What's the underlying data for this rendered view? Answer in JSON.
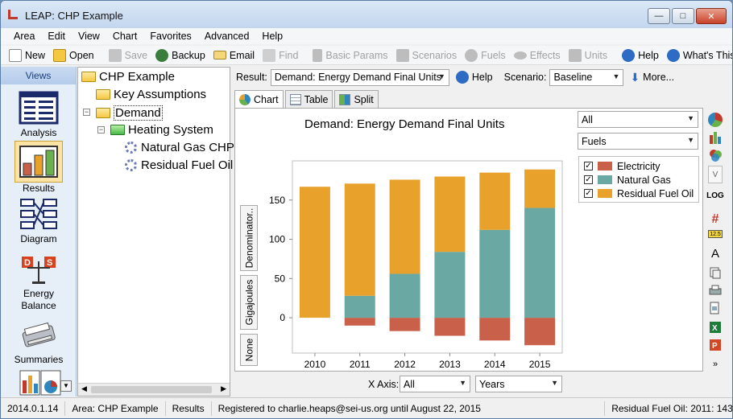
{
  "window": {
    "title": "LEAP: CHP Example",
    "controls": {
      "minimize": "—",
      "maximize": "□",
      "close": "✕"
    }
  },
  "menu": [
    "Area",
    "Edit",
    "View",
    "Chart",
    "Favorites",
    "Advanced",
    "Help"
  ],
  "toolbar": {
    "new": "New",
    "open": "Open",
    "save": "Save",
    "backup": "Backup",
    "email": "Email",
    "find": "Find",
    "basic_params": "Basic Params",
    "scenarios": "Scenarios",
    "fuels": "Fuels",
    "effects": "Effects",
    "units": "Units",
    "help": "Help",
    "whats_this": "What's This?"
  },
  "views": {
    "header": "Views",
    "items": [
      "Analysis",
      "Results",
      "Diagram",
      "Energy Balance",
      "Summaries"
    ],
    "active": "Results"
  },
  "tree": {
    "root": "CHP Example",
    "key_assumptions": "Key Assumptions",
    "demand": "Demand",
    "heating_system": "Heating System",
    "natural_gas_chp": "Natural Gas CHP",
    "residual_fuel_oil": "Residual Fuel Oil"
  },
  "resultbar": {
    "result_label": "Result:",
    "result_value": "Demand: Energy Demand Final Units",
    "help": "Help",
    "scenario_label": "Scenario:",
    "scenario_value": "Baseline",
    "more": "More..."
  },
  "tabs": [
    "Chart",
    "Table",
    "Split"
  ],
  "vertical_tabs": [
    "Denominator..",
    "Gigajoules",
    "None"
  ],
  "filters": {
    "branch": "All",
    "legend_dim": "Fuels"
  },
  "xaxis": {
    "label": "X Axis:",
    "value": "All",
    "dimension": "Years"
  },
  "statusbar": {
    "version": "2014.0.1.14",
    "area": "Area: CHP Example",
    "view": "Results",
    "registration": "Registered to charlie.heaps@sei-us.org until August 22, 2015",
    "hover": "Residual Fuel Oil: 2011: 143"
  },
  "colors": {
    "electricity": "#c9604a",
    "natural_gas": "#6aa8a4",
    "residual_fuel_oil": "#e8a22c"
  },
  "chart_data": {
    "type": "bar",
    "stacked": true,
    "title": "Demand: Energy Demand Final Units",
    "categories": [
      "2010",
      "2011",
      "2012",
      "2013",
      "2014",
      "2015"
    ],
    "series": [
      {
        "name": "Electricity",
        "values": [
          0,
          -10,
          -17,
          -23,
          -29,
          -35
        ]
      },
      {
        "name": "Natural Gas",
        "values": [
          0,
          28,
          56,
          84,
          112,
          140
        ]
      },
      {
        "name": "Residual Fuel Oil",
        "values": [
          167,
          143,
          120,
          96,
          73,
          49
        ]
      }
    ],
    "yticks": [
      0,
      50,
      100,
      150
    ],
    "ylim": [
      -45,
      200
    ],
    "grid": false,
    "legend": "right"
  }
}
